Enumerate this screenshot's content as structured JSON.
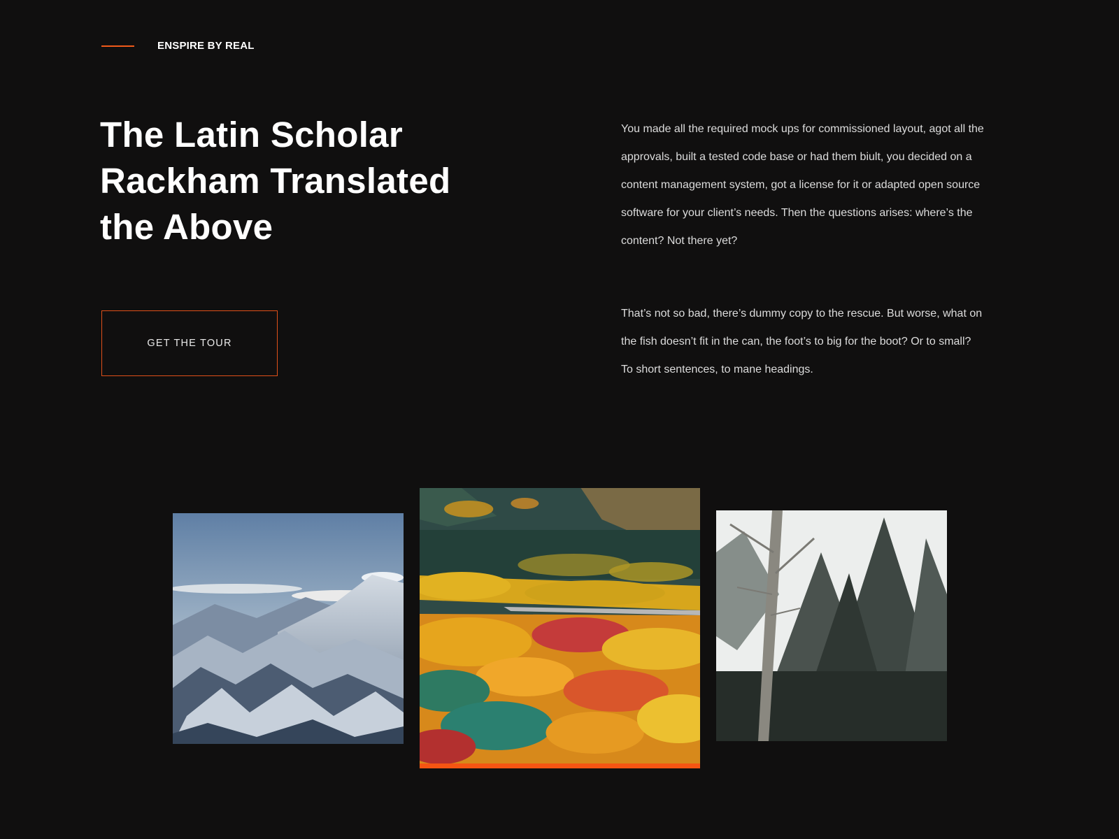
{
  "eyebrow": {
    "text": "ENSPIRE BY REAL"
  },
  "hero": {
    "heading_lines": [
      "The Latin Scholar",
      "Rackham Translated",
      "the Above"
    ],
    "cta_label": "GET THE TOUR"
  },
  "copy": {
    "paragraph_1": "You made all the required mock ups for commissioned layout, agot all the approvals, built a tested code base or had them biult, you decided on a content management system, got a license for it or adapted open source software for your client’s needs. Then the questions arises: where’s the content? Not there yet?",
    "paragraph_2": "That’s not so bad, there’s dummy copy to the rescue. But worse, what on the fish doesn’t fit in the can, the foot’s to big for the boot? Or to small? To short sentences, to mane headings."
  },
  "gallery": {
    "active_index": 1
  },
  "colors": {
    "background": "#100f0f",
    "accent": "#f05a1a",
    "text": "#ffffff",
    "body_text": "#dcdcdc"
  }
}
